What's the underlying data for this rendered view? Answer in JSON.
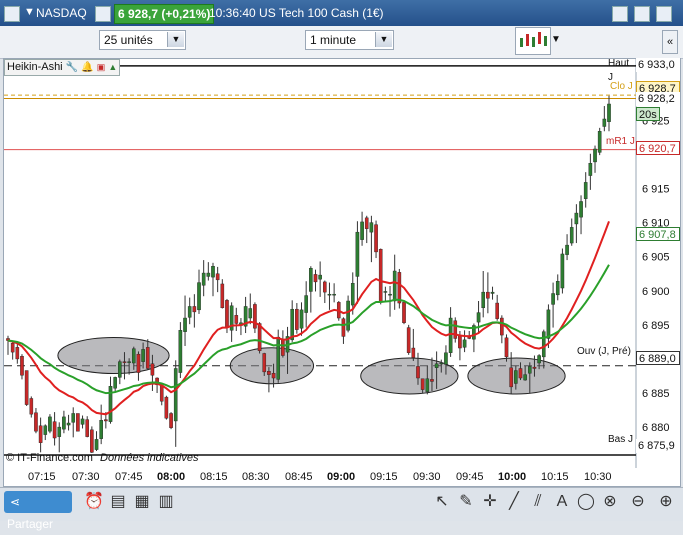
{
  "titlebar": {
    "market": "NASDAQ",
    "price_badge": "6 928,7 (+0,21%)",
    "time_and_name": "10:36:40 US Tech 100 Cash (1€)"
  },
  "toolbar": {
    "units_value": "25 unités",
    "interval_value": "1 minute"
  },
  "indicator": {
    "label": "Heikin-Ashi"
  },
  "price_labels": {
    "haut": "Haut J",
    "top": "6 933,0",
    "current": "6 928,7",
    "current_b": "6 928,2",
    "clo": "Clo J",
    "timer": "20s",
    "mr1": "mR1 J",
    "mr1_value": "6 920,7",
    "ma_value": "6 907,8",
    "ouv": "Ouv (J, Pré)",
    "ouv_value": "6 889,0",
    "bas": "Bas J",
    "bas_value": "6 875,9"
  },
  "y_ticks": [
    "6 925",
    "6 915",
    "6 910",
    "6 905",
    "6 900",
    "6 895",
    "6 885",
    "6 880"
  ],
  "x_ticks": [
    "07:15",
    "07:30",
    "07:45",
    "08:00",
    "08:15",
    "08:30",
    "08:45",
    "09:00",
    "09:15",
    "09:30",
    "09:45",
    "10:00",
    "10:15",
    "10:30"
  ],
  "footer": {
    "source": "© IT-Finance.com",
    "note": "Données indicatives"
  },
  "bottombar": {
    "share_label": "Partager"
  },
  "colors": {
    "up": "#2e7d32",
    "down": "#c62828",
    "ma_red": "#e02020",
    "ma_green": "#2aa02a",
    "mr1_line": "#e05050",
    "clo_line": "#d4a017"
  },
  "chart_data": {
    "type": "candlestick",
    "ylim": [
      6874,
      6934
    ],
    "candles": [
      [
        6893.0,
        6893.4,
        6890.6,
        6892.7
      ],
      [
        6892.3,
        6892.7,
        6889.9,
        6891.0
      ],
      [
        6891.7,
        6892.3,
        6889.3,
        6890.0
      ],
      [
        6890.4,
        6890.7,
        6887.0,
        6887.6
      ],
      [
        6888.3,
        6888.3,
        6883.1,
        6883.3
      ],
      [
        6884.2,
        6884.5,
        6881.4,
        6881.9
      ],
      [
        6882.1,
        6882.8,
        6879.1,
        6879.4
      ],
      [
        6880.2,
        6881.4,
        6876.3,
        6877.7
      ],
      [
        6878.9,
        6880.4,
        6878.1,
        6880.2
      ],
      [
        6879.4,
        6881.9,
        6879.1,
        6881.5
      ],
      [
        6880.8,
        6882.2,
        6877.3,
        6878.4
      ],
      [
        6878.6,
        6880.7,
        6876.3,
        6880.0
      ],
      [
        6879.7,
        6882.4,
        6879.1,
        6881.5
      ],
      [
        6880.3,
        6881.8,
        6879.5,
        6880.6
      ],
      [
        6880.7,
        6882.9,
        6878.5,
        6882.0
      ],
      [
        6882.0,
        6882.0,
        6879.4,
        6879.4
      ],
      [
        6880.4,
        6881.7,
        6879.8,
        6881.2
      ],
      [
        6881.1,
        6881.6,
        6878.5,
        6878.6
      ],
      [
        6879.6,
        6880.1,
        6876.2,
        6876.3
      ],
      [
        6876.7,
        6879.4,
        6876.5,
        6878.2
      ],
      [
        6878.3,
        6883.3,
        6877.5,
        6881.0
      ],
      [
        6881.1,
        6882.2,
        6879.8,
        6880.9
      ],
      [
        6880.8,
        6887.4,
        6880.5,
        6886.0
      ],
      [
        6885.7,
        6887.4,
        6885.2,
        6887.3
      ],
      [
        6887.3,
        6889.9,
        6886.3,
        6889.6
      ],
      [
        6889.6,
        6891.0,
        6887.0,
        6889.5
      ],
      [
        6889.5,
        6890.1,
        6887.7,
        6889.6
      ],
      [
        6889.4,
        6891.8,
        6888.4,
        6891.5
      ],
      [
        6890.7,
        6891.1,
        6886.8,
        6888.0
      ],
      [
        6889.6,
        6892.4,
        6888.6,
        6891.4
      ],
      [
        6891.7,
        6892.9,
        6888.4,
        6888.6
      ],
      [
        6889.3,
        6890.6,
        6885.3,
        6887.6
      ],
      [
        6887.2,
        6887.3,
        6885.0,
        6886.2
      ],
      [
        6886.1,
        6886.1,
        6883.2,
        6883.8
      ],
      [
        6884.4,
        6884.6,
        6881.1,
        6881.3
      ],
      [
        6882.0,
        6882.2,
        6879.7,
        6879.9
      ],
      [
        6880.9,
        6889.8,
        6877.1,
        6888.6
      ],
      [
        6888.0,
        6895.4,
        6887.2,
        6894.2
      ],
      [
        6894.0,
        6899.3,
        6891.9,
        6896.0
      ],
      [
        6896.1,
        6899.0,
        6895.1,
        6897.7
      ],
      [
        6897.7,
        6899.5,
        6894.6,
        6896.9
      ],
      [
        6897.2,
        6903.1,
        6896.6,
        6901.2
      ],
      [
        6900.8,
        6904.5,
        6899.2,
        6902.6
      ],
      [
        6902.1,
        6904.2,
        6901.5,
        6902.6
      ],
      [
        6902.0,
        6904.1,
        6899.2,
        6903.6
      ],
      [
        6902.5,
        6903.5,
        6899.8,
        6901.6
      ],
      [
        6901.0,
        6901.7,
        6897.4,
        6897.5
      ],
      [
        6898.6,
        6898.8,
        6893.8,
        6894.6
      ],
      [
        6894.2,
        6898.3,
        6892.5,
        6897.8
      ],
      [
        6896.4,
        6897.5,
        6894.1,
        6895.2
      ],
      [
        6894.9,
        6896.0,
        6893.5,
        6895.3
      ],
      [
        6894.8,
        6899.1,
        6893.8,
        6897.7
      ],
      [
        6896.0,
        6899.6,
        6895.1,
        6897.4
      ],
      [
        6898.0,
        6898.3,
        6893.8,
        6894.5
      ],
      [
        6895.2,
        6895.4,
        6890.8,
        6891.2
      ],
      [
        6890.8,
        6890.9,
        6887.5,
        6888.1
      ],
      [
        6888.2,
        6888.8,
        6885.1,
        6887.7
      ],
      [
        6887.9,
        6889.3,
        6885.8,
        6887.2
      ],
      [
        6887.0,
        6894.3,
        6886.5,
        6893.2
      ],
      [
        6892.8,
        6894.2,
        6890.2,
        6890.5
      ],
      [
        6891.0,
        6894.7,
        6887.8,
        6893.3
      ],
      [
        6892.8,
        6898.6,
        6892.5,
        6897.3
      ],
      [
        6897.3,
        6898.2,
        6893.7,
        6894.3
      ],
      [
        6894.5,
        6898.3,
        6893.4,
        6897.2
      ],
      [
        6896.8,
        6901.4,
        6894.6,
        6899.3
      ],
      [
        6899.9,
        6903.6,
        6896.8,
        6903.3
      ],
      [
        6902.4,
        6903.1,
        6899.9,
        6901.3
      ],
      [
        6901.7,
        6904.3,
        6899.1,
        6902.3
      ],
      [
        6901.3,
        6901.5,
        6898.2,
        6899.8
      ],
      [
        6899.4,
        6901.2,
        6897.2,
        6899.5
      ],
      [
        6899.4,
        6901.1,
        6898.3,
        6899.5
      ],
      [
        6898.3,
        6898.5,
        6895.6,
        6896.0
      ],
      [
        6895.9,
        6896.1,
        6892.2,
        6893.3
      ],
      [
        6894.2,
        6899.3,
        6893.9,
        6898.5
      ],
      [
        6897.9,
        6902.7,
        6896.5,
        6901.1
      ],
      [
        6902.1,
        6910.2,
        6898.1,
        6908.6
      ],
      [
        6907.5,
        6911.6,
        6906.6,
        6910.1
      ],
      [
        6910.7,
        6911.0,
        6907.0,
        6909.1
      ],
      [
        6908.6,
        6911.0,
        6904.2,
        6910.0
      ],
      [
        6909.7,
        6910.3,
        6904.8,
        6905.7
      ],
      [
        6906.1,
        6906.2,
        6898.0,
        6898.4
      ],
      [
        6899.9,
        6900.6,
        6898.3,
        6899.9
      ],
      [
        6899.4,
        6900.7,
        6896.2,
        6899.5
      ],
      [
        6898.5,
        6905.3,
        6897.2,
        6902.9
      ],
      [
        6902.7,
        6903.2,
        6897.4,
        6898.2
      ],
      [
        6898.3,
        6898.6,
        6895.1,
        6895.3
      ],
      [
        6894.6,
        6895.0,
        6890.6,
        6890.9
      ],
      [
        6891.6,
        6894.4,
        6889.7,
        6890.2
      ],
      [
        6888.9,
        6890.9,
        6886.2,
        6887.2
      ],
      [
        6887.1,
        6887.1,
        6885.0,
        6885.5
      ],
      [
        6885.2,
        6889.0,
        6884.8,
        6887.1
      ],
      [
        6887.0,
        6890.2,
        6885.3,
        6886.7
      ],
      [
        6888.7,
        6891.1,
        6885.6,
        6889.3
      ],
      [
        6889.4,
        6889.9,
        6888.0,
        6889.4
      ],
      [
        6889.2,
        6892.0,
        6887.7,
        6890.9
      ],
      [
        6890.9,
        6897.6,
        6890.3,
        6896.0
      ],
      [
        6895.6,
        6896.1,
        6892.4,
        6893.0
      ],
      [
        6893.4,
        6894.1,
        6889.8,
        6891.6
      ],
      [
        6891.7,
        6894.2,
        6891.0,
        6892.8
      ],
      [
        6893.3,
        6894.1,
        6892.9,
        6893.0
      ],
      [
        6892.9,
        6895.2,
        6891.0,
        6894.9
      ],
      [
        6895.4,
        6898.5,
        6893.7,
        6896.8
      ],
      [
        6897.5,
        6902.9,
        6896.1,
        6899.8
      ],
      [
        6899.8,
        6902.7,
        6896.7,
        6898.9
      ],
      [
        6899.6,
        6900.6,
        6898.7,
        6899.8
      ],
      [
        6898.2,
        6899.4,
        6895.6,
        6895.9
      ],
      [
        6896.0,
        6896.4,
        6892.3,
        6893.5
      ],
      [
        6893.1,
        6893.6,
        6889.6,
        6890.3
      ],
      [
        6888.7,
        6891.0,
        6884.9,
        6885.9
      ],
      [
        6886.4,
        6889.0,
        6885.5,
        6888.3
      ],
      [
        6888.6,
        6889.5,
        6886.9,
        6887.2
      ],
      [
        6886.9,
        6889.0,
        6886.8,
        6887.7
      ],
      [
        6887.9,
        6889.5,
        6884.9,
        6888.9
      ],
      [
        6888.8,
        6890.5,
        6887.4,
        6888.6
      ],
      [
        6889.4,
        6890.7,
        6888.5,
        6890.5
      ],
      [
        6890.3,
        6894.3,
        6888.6,
        6894.0
      ],
      [
        6893.0,
        6898.0,
        6891.6,
        6897.2
      ],
      [
        6898.0,
        6901.2,
        6894.6,
        6899.6
      ],
      [
        6899.4,
        6902.4,
        6898.6,
        6901.4
      ],
      [
        6900.4,
        6906.2,
        6899.6,
        6905.4
      ],
      [
        6905.3,
        6908.3,
        6904.5,
        6906.7
      ],
      [
        6907.0,
        6910.6,
        6906.6,
        6909.3
      ],
      [
        6909.8,
        6912.7,
        6907.0,
        6911.4
      ],
      [
        6910.8,
        6914.0,
        6908.3,
        6913.1
      ],
      [
        6913.5,
        6917.4,
        6912.2,
        6915.9
      ],
      [
        6916.9,
        6920.1,
        6914.8,
        6918.7
      ],
      [
        6918.9,
        6921.3,
        6917.3,
        6920.8
      ],
      [
        6920.3,
        6923.9,
        6919.9,
        6923.4
      ],
      [
        6924.1,
        6927.1,
        6923.4,
        6925.2
      ],
      [
        6924.8,
        6928.6,
        6923.4,
        6927.4
      ]
    ]
  }
}
